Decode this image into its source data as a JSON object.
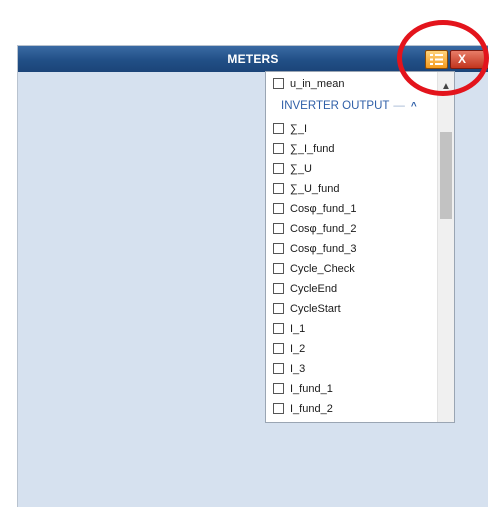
{
  "window": {
    "title": "METERS"
  },
  "toolbar": {
    "menu_icon": "list-menu-icon",
    "close_icon": "close-icon",
    "close_label": "X"
  },
  "dropdown": {
    "top_item": "u_in_mean",
    "group": {
      "label": "INVERTER OUTPUT",
      "dash": "—",
      "toggle_icon": "chevron-up-icon"
    },
    "items": [
      "∑_I",
      "∑_I_fund",
      "∑_U",
      "∑_U_fund",
      "Cosφ_fund_1",
      "Cosφ_fund_2",
      "Cosφ_fund_3",
      "Cycle_Check",
      "CycleEnd",
      "CycleStart",
      "I_1",
      "I_2",
      "I_3",
      "I_fund_1",
      "I_fund_2"
    ]
  },
  "scrollbar": {
    "up_icon": "scroll-up-icon"
  },
  "colors": {
    "titlebar": "#214f86",
    "panel_bg": "#d6e1ef",
    "group_text": "#2f5fa8",
    "highlight": "#e3141c",
    "menu_button": "#f39a1e"
  }
}
